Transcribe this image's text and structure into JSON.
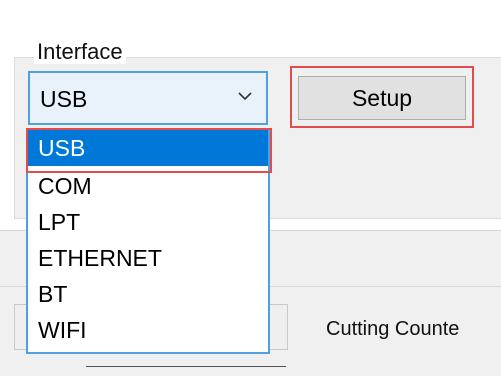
{
  "interface": {
    "group_label": "Interface",
    "selected_value": "USB",
    "options": [
      "USB",
      "COM",
      "LPT",
      "ETHERNET",
      "BT",
      "WIFI"
    ]
  },
  "setup": {
    "label": "Setup"
  },
  "cutting": {
    "label": "Cutting Counte"
  },
  "colors": {
    "accent": "#4fa0df",
    "selection": "#0078d7",
    "highlight": "#e24c4c"
  },
  "icons": {
    "dropdown_arrow": "chevron-down-icon"
  }
}
